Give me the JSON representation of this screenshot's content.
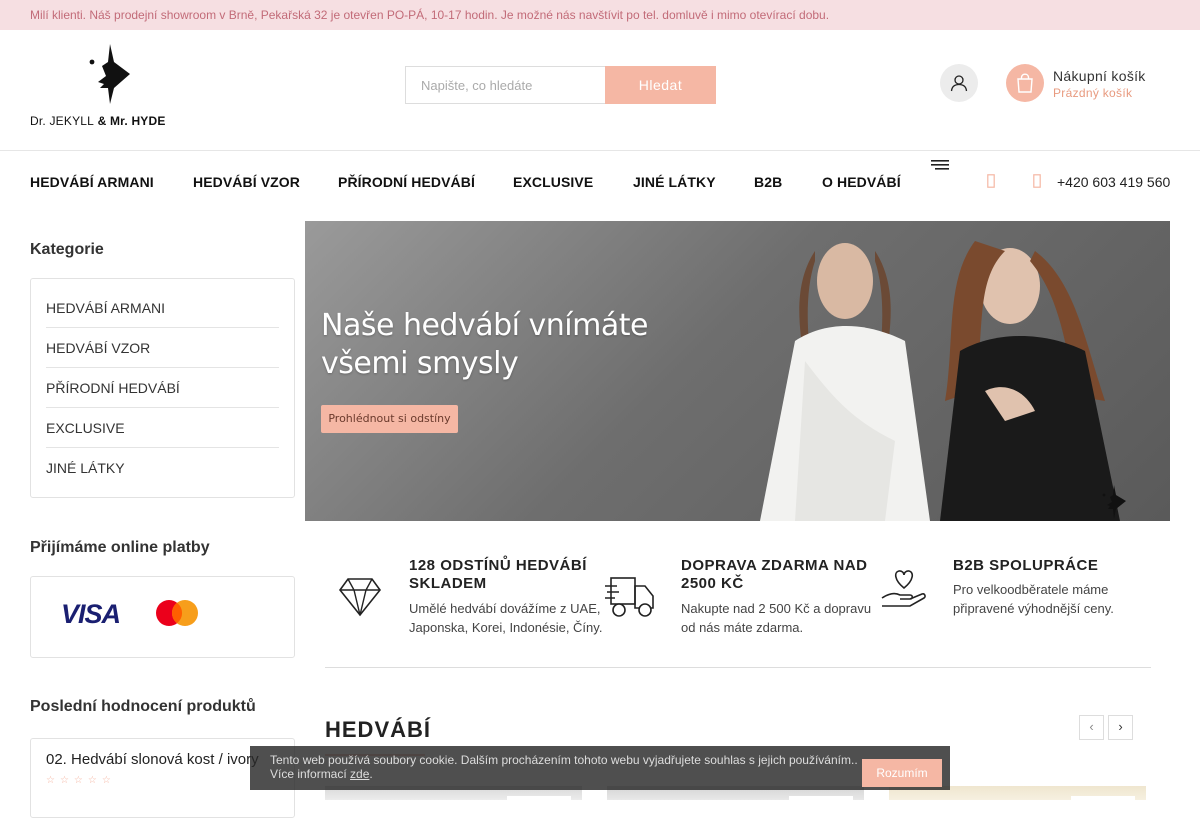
{
  "topbar": {
    "text": "Milí klienti. Náš prodejní showroom v Brně, Pekařská 32 je otevřen PO-PÁ, 10-17 hodin. Je možné nás navštívit po tel. domluvě i mimo otevírací dobu."
  },
  "header": {
    "logo_text_1": "Dr. JEKYLL",
    "logo_text_amp": " & ",
    "logo_text_2": "Mr. HYDE",
    "search_placeholder": "Napište, co hledáte",
    "search_button": "Hledat",
    "cart_title": "Nákupní košík",
    "cart_status": "Prázdný košík"
  },
  "nav": {
    "items": [
      "HEDVÁBÍ ARMANI",
      "HEDVÁBÍ VZOR",
      "PŘÍRODNÍ HEDVÁBÍ",
      "EXCLUSIVE",
      "JINÉ LÁTKY",
      "B2B",
      "O HEDVÁBÍ"
    ],
    "phone": "+420 603 419 560"
  },
  "sidebar": {
    "categories_heading": "Kategorie",
    "categories": [
      "HEDVÁBÍ ARMANI",
      "HEDVÁBÍ VZOR",
      "PŘÍRODNÍ HEDVÁBÍ",
      "EXCLUSIVE",
      "JINÉ LÁTKY"
    ],
    "payments_heading": "Přijímáme online platby",
    "visa_label": "VISA",
    "reviews_heading": "Poslední hodnocení produktů",
    "review_product": "02. Hedvábí slonová kost / ivory",
    "review_rating": 0,
    "review_stars": "☆☆☆☆☆"
  },
  "banner": {
    "title_line1": "Naše hedvábí vnímáte",
    "title_line2": "všemi smysly",
    "button": "Prohlédnout si odstíny"
  },
  "features": [
    {
      "icon": "diamond-icon",
      "title": "128 ODSTÍNŮ HEDVÁBÍ SKLADEM",
      "desc": "Umělé hedvábí dovážíme z UAE, Japonska, Korei, Indonésie, Číny."
    },
    {
      "icon": "truck-icon",
      "title": "DOPRAVA ZDARMA NAD 2500 KČ",
      "desc": "Nakupte nad 2 500 Kč a dopravu od nás máte zdarma."
    },
    {
      "icon": "hand-heart-icon",
      "title": "B2B SPOLUPRÁCE",
      "desc": "Pro velkoodběratele máme připravené výhodnější ceny."
    }
  ],
  "section": {
    "title": "HEDVÁBÍ",
    "prev": "‹",
    "next": "›"
  },
  "cookie": {
    "text": "Tento web používá soubory cookie. Dalším procházením tohoto webu vyjadřujete souhlas s jejich používáním..",
    "more_prefix": "Více informací ",
    "more_link": "zde",
    "more_suffix": ".",
    "button": "Rozumím"
  },
  "colors": {
    "accent": "#f5b7a4",
    "topbar_bg": "#f6dfe2",
    "topbar_text": "#c26b78"
  }
}
